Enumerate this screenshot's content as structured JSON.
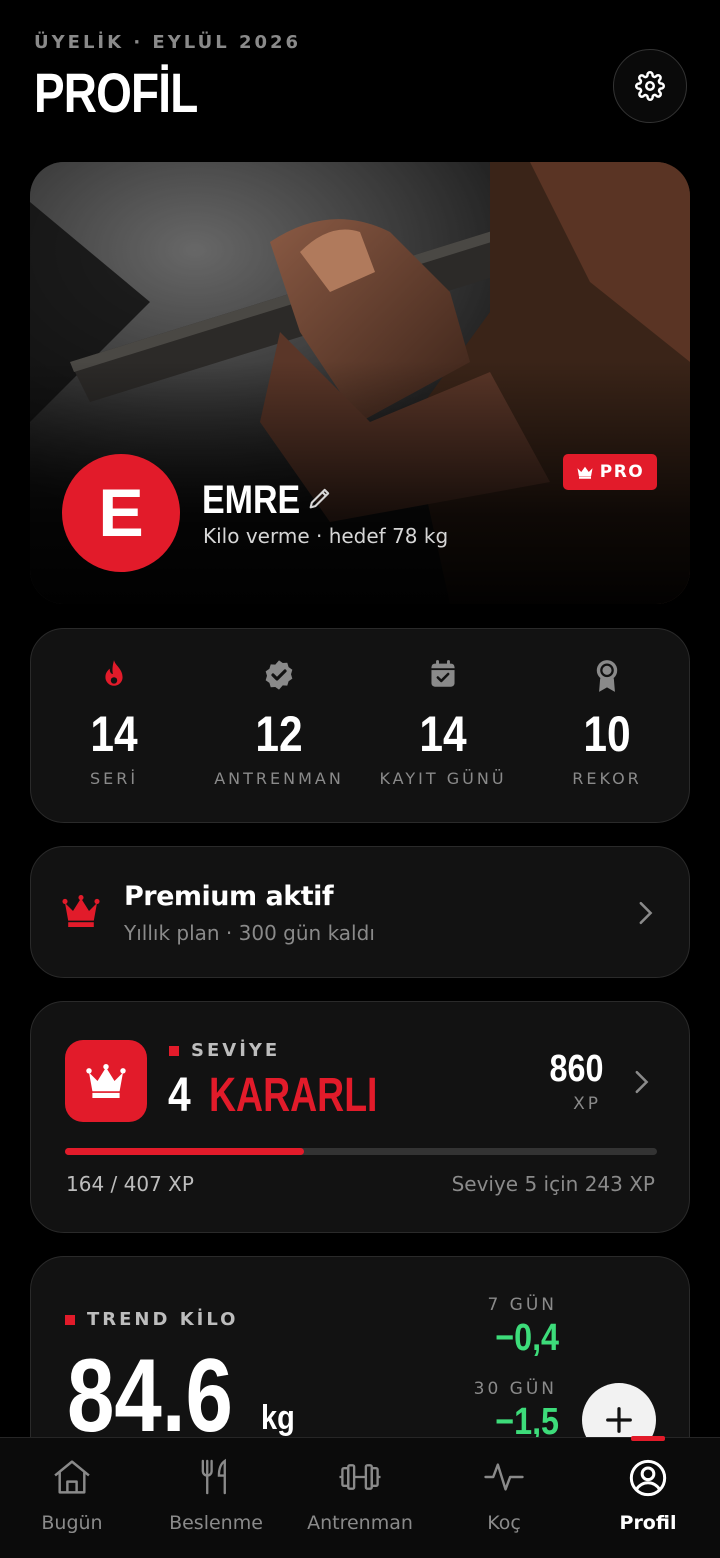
{
  "header": {
    "caption": "ÜYELİK · EYLÜL 2026",
    "title": "PROFİL",
    "settings_icon": "gear-icon"
  },
  "profile": {
    "initial": "E",
    "name": "EMRE",
    "goal": "Kilo verme · hedef 78 kg",
    "badge": "PRO"
  },
  "stats": [
    {
      "icon": "flame-icon",
      "value": "14",
      "label": "SERİ"
    },
    {
      "icon": "verified-badge-icon",
      "value": "12",
      "label": "ANTRENMAN"
    },
    {
      "icon": "calendar-check-icon",
      "value": "14",
      "label": "KAYIT GÜNÜ"
    },
    {
      "icon": "medal-icon",
      "value": "10",
      "label": "REKOR"
    }
  ],
  "premium": {
    "title": "Premium aktif",
    "subtitle": "Yıllık plan · 300 gün kaldı"
  },
  "level": {
    "caption": "SEVİYE",
    "number": "4",
    "name": "KARARLI",
    "xp_value": "860",
    "xp_label": "XP",
    "progress_text": "164 / 407 XP",
    "progress_fraction": 0.403,
    "next_text": "Seviye 5 için 243 XP"
  },
  "trend": {
    "caption": "TREND KİLO",
    "value": "84.6",
    "unit": "kg",
    "d7_label": "7 GÜN",
    "d7_value": "−0,4",
    "d30_label": "30 GÜN",
    "d30_value": "−1,5"
  },
  "tabs": [
    {
      "label": "Bugün",
      "icon": "home-icon"
    },
    {
      "label": "Beslenme",
      "icon": "utensils-icon"
    },
    {
      "label": "Antrenman",
      "icon": "dumbbell-icon"
    },
    {
      "label": "Koç",
      "icon": "pulse-icon"
    },
    {
      "label": "Profil",
      "icon": "user-circle-icon",
      "active": true
    }
  ],
  "colors": {
    "accent": "#e21b2a",
    "positive": "#3ddc7a",
    "background": "#000000",
    "card": "#121212"
  }
}
